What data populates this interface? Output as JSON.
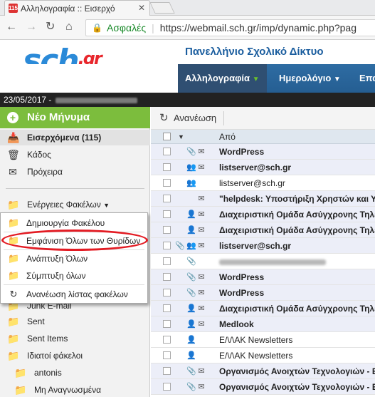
{
  "browser": {
    "tab_title": "Αλληλογραφία :: Εισερχό",
    "favicon_text": "115",
    "close_glyph": "✕",
    "secure_label": "Ασφαλές",
    "url": "https://webmail.sch.gr/imp/dynamic.php?pag",
    "back_icon": "arrow-left",
    "forward_icon": "arrow-right",
    "reload_icon": "reload",
    "home_icon": "home"
  },
  "site": {
    "logo_text": "sch",
    "logo_suffix": ".gr",
    "name": "Πανελλήνιο Σχολικό Δίκτυο"
  },
  "menu": {
    "items": [
      {
        "label": "Αλληλογραφία",
        "active": true
      },
      {
        "label": "Ημερολόγιο",
        "active": false
      },
      {
        "label": "Επα",
        "active": false
      }
    ]
  },
  "datebar": {
    "date": "23/05/2017 -"
  },
  "sidebar": {
    "new_message": "Νέο Μήνυμα",
    "folders": [
      {
        "label": "Εισερχόμενα (115)",
        "icon": "inbox-icon"
      },
      {
        "label": "Κάδος",
        "icon": "trash-icon"
      },
      {
        "label": "Πρόχειρα",
        "icon": "drafts-icon"
      }
    ],
    "folder_actions": "Ενέργειες Φακέλων",
    "more_folders": [
      {
        "label": "Junk E-mail"
      },
      {
        "label": "Sent"
      },
      {
        "label": "Sent Items"
      },
      {
        "label": "Ιδιατοί φάκελοι"
      },
      {
        "label": "antonis"
      },
      {
        "label": "Μη Αναγνωσμένα"
      }
    ]
  },
  "context_menu": {
    "items": [
      "Δημιουργία Φακέλου",
      "Εμφάνιση Όλων των Θυρίδων",
      "Ανάπτυξη Όλων",
      "Σύμπτυξη όλων",
      "Ανανέωση λίστας φακέλων"
    ]
  },
  "toolbar": {
    "refresh_label": "Ανανέωση"
  },
  "list": {
    "from_header": "Από",
    "rows": [
      {
        "from": "WordPress",
        "unread": true,
        "icons": [
          "",
          "attach",
          "mail"
        ]
      },
      {
        "from": "listserver@sch.gr",
        "unread": true,
        "icons": [
          "",
          "group",
          "mail"
        ]
      },
      {
        "from": "listserver@sch.gr",
        "unread": false,
        "icons": [
          "",
          "group",
          ""
        ]
      },
      {
        "from": "\"helpdesk: Υποστήριξη Χρηστών και Υπ",
        "unread": true,
        "icons": [
          "",
          "",
          "mail"
        ]
      },
      {
        "from": "Διαχειριστική Ομάδα Ασύγχρονης Τηλε",
        "unread": true,
        "icons": [
          "",
          "person",
          "mail"
        ]
      },
      {
        "from": "Διαχειριστική Ομάδα Ασύγχρονης Τηλε",
        "unread": true,
        "icons": [
          "",
          "person",
          "mail"
        ]
      },
      {
        "from": "listserver@sch.gr",
        "unread": true,
        "icons": [
          "attach",
          "group",
          "mail"
        ]
      },
      {
        "from": "",
        "unread": false,
        "icons": [
          "",
          "attach",
          ""
        ],
        "blurred": true
      },
      {
        "from": "WordPress",
        "unread": true,
        "icons": [
          "",
          "attach",
          "mail"
        ]
      },
      {
        "from": "WordPress",
        "unread": true,
        "icons": [
          "",
          "attach",
          "mail"
        ]
      },
      {
        "from": "Διαχειριστική Ομάδα Ασύγχρονης Τηλε",
        "unread": true,
        "icons": [
          "",
          "person",
          "mail"
        ]
      },
      {
        "from": "Medlook",
        "unread": true,
        "icons": [
          "",
          "person",
          "mail"
        ]
      },
      {
        "from": "Ε/\\/\\ΑΚ Newsletters",
        "unread": false,
        "icons": [
          "",
          "person",
          ""
        ]
      },
      {
        "from": "Ε/\\/\\ΑΚ Newsletters",
        "unread": false,
        "icons": [
          "",
          "person",
          ""
        ]
      },
      {
        "from": "Οργανισμός Ανοιχτών Τεχνολογιών - Ε",
        "unread": true,
        "icons": [
          "",
          "attach",
          "mail"
        ]
      },
      {
        "from": "Οργανισμός Ανοιχτών Τεχνολογιών - Ε",
        "unread": true,
        "icons": [
          "",
          "attach",
          "mail"
        ]
      }
    ]
  },
  "colors": {
    "new_message_bg": "#7cbd3d",
    "menubar_bg": "#2e6ca3",
    "highlight_oval": "#e31b23",
    "unread_row_bg": "#eceef8"
  }
}
